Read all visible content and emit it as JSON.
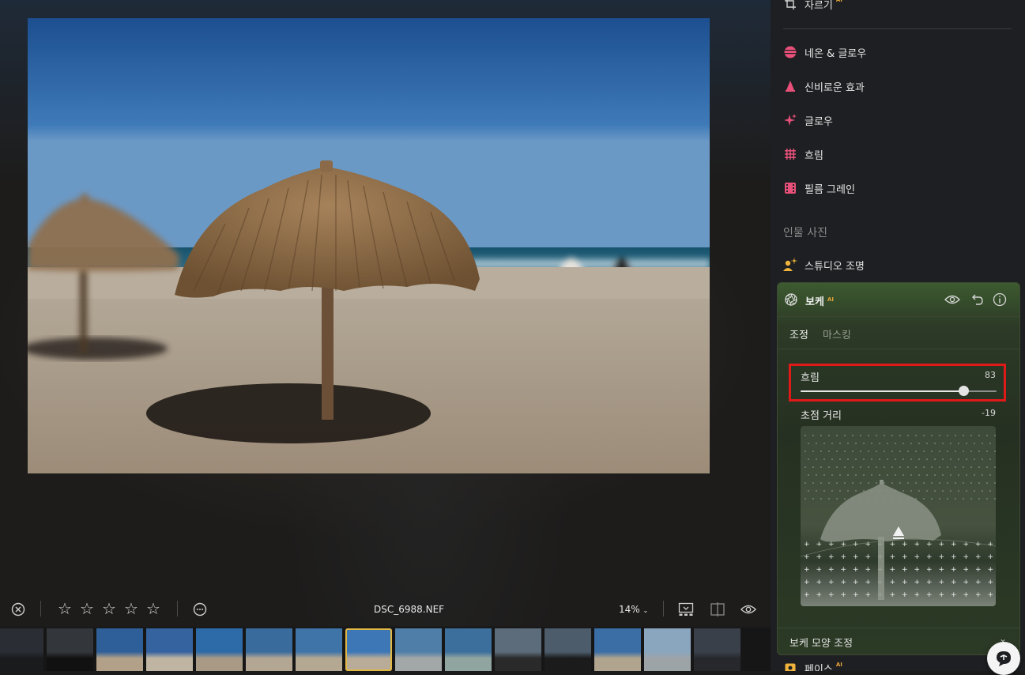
{
  "viewer": {
    "filename": "DSC_6988.NEF",
    "zoom_label": "14%",
    "rating": 0,
    "rating_max": 5
  },
  "filmstrip": {
    "thumbnail_count": 15,
    "selected_index": 7
  },
  "panel": {
    "crop_label": "자르기",
    "ai_badge": "AI",
    "tools": [
      {
        "label": "네온 & 글로우",
        "icon": "neon-glow-icon",
        "color": "#e8507a"
      },
      {
        "label": "신비로운 효과",
        "icon": "mystical-effect-icon",
        "color": "#e8507a"
      },
      {
        "label": "글로우",
        "icon": "glow-sparkle-icon",
        "color": "#e8507a"
      },
      {
        "label": "흐림",
        "icon": "blur-grid-icon",
        "color": "#e8507a"
      },
      {
        "label": "필름 그레인",
        "icon": "film-grain-icon",
        "color": "#e8507a"
      }
    ],
    "portrait_section": "인물 사진",
    "studio_light_label": "스튜디오 조명",
    "bokeh": {
      "title": "보케",
      "tabs": [
        "조정",
        "마스킹"
      ],
      "active_tab": 0,
      "blur_label": "흐림",
      "blur_value": "83",
      "blur_fraction": 0.83,
      "focus_label": "초점 거리",
      "focus_value": "-19",
      "shape_label": "보케 모양 조정"
    },
    "face_label": "페이스",
    "accent_color": "#e2b845",
    "highlight_color": "#e01919"
  }
}
